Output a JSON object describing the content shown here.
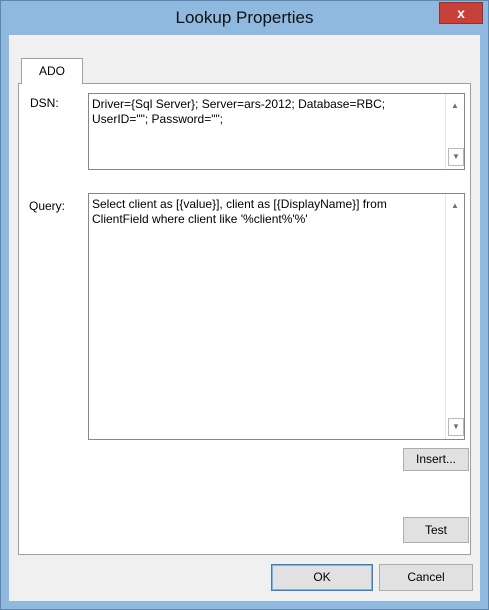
{
  "window": {
    "title": "Lookup Properties",
    "close_glyph": "x"
  },
  "tabs": [
    {
      "label": "ADO"
    }
  ],
  "dsn": {
    "label": "DSN:",
    "value": "Driver={Sql Server}; Server=ars-2012; Database=RBC; UserID=\"\"; Password=\"\";"
  },
  "query": {
    "label": "Query:",
    "value": "Select client as [{value}], client as [{DisplayName}] from ClientField where client like '%client%'%'"
  },
  "buttons": {
    "insert": "Insert...",
    "test": "Test",
    "ok": "OK",
    "cancel": "Cancel"
  },
  "icons": {
    "scroll_up": "scroll-up-arrow-icon",
    "scroll_down": "scroll-down-arrow-icon"
  },
  "colors": {
    "titlebar": "#8fb9de",
    "close_button": "#c7403a",
    "dialog_background": "#f0f0f0"
  }
}
